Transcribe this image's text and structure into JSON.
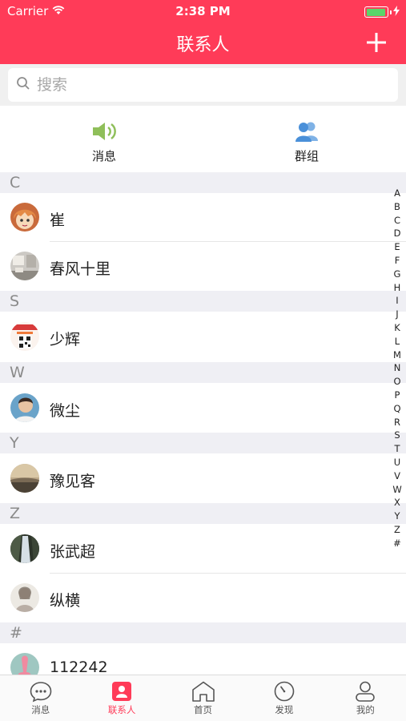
{
  "status_bar": {
    "carrier": "Carrier",
    "time": "2:38 PM",
    "battery_level": 0.95
  },
  "nav": {
    "title": "联系人",
    "add_icon": "plus-icon"
  },
  "search": {
    "placeholder": "搜索",
    "value": ""
  },
  "shortcuts": [
    {
      "label": "消息",
      "icon": "speaker-icon",
      "color": "#8fbf5a"
    },
    {
      "label": "群组",
      "icon": "group-icon",
      "color": "#4a90d9"
    }
  ],
  "sections": [
    {
      "letter": "C",
      "contacts": [
        {
          "name": "崔",
          "avatar": "anime-girl-avatar"
        },
        {
          "name": "春风十里",
          "avatar": "room-photo-avatar"
        }
      ]
    },
    {
      "letter": "S",
      "contacts": [
        {
          "name": "少辉",
          "avatar": "qr-poster-avatar"
        }
      ]
    },
    {
      "letter": "W",
      "contacts": [
        {
          "name": "微尘",
          "avatar": "man-portrait-avatar"
        }
      ]
    },
    {
      "letter": "Y",
      "contacts": [
        {
          "name": "豫见客",
          "avatar": "sunset-avatar"
        }
      ]
    },
    {
      "letter": "Z",
      "contacts": [
        {
          "name": "张武超",
          "avatar": "waterfall-avatar"
        },
        {
          "name": "纵横",
          "avatar": "sketch-avatar"
        }
      ]
    },
    {
      "letter": "#",
      "contacts": [
        {
          "name": "112242",
          "avatar": "flamingo-avatar"
        }
      ]
    }
  ],
  "index_letters": [
    "A",
    "B",
    "C",
    "D",
    "E",
    "F",
    "G",
    "H",
    "I",
    "J",
    "K",
    "L",
    "M",
    "N",
    "O",
    "P",
    "Q",
    "R",
    "S",
    "T",
    "U",
    "V",
    "W",
    "X",
    "Y",
    "Z",
    "#"
  ],
  "tabs": [
    {
      "label": "消息",
      "icon": "chat-bubble-icon",
      "active": false
    },
    {
      "label": "联系人",
      "icon": "contact-card-icon",
      "active": true
    },
    {
      "label": "首页",
      "icon": "home-icon",
      "active": false
    },
    {
      "label": "发现",
      "icon": "compass-icon",
      "active": false
    },
    {
      "label": "我的",
      "icon": "person-icon",
      "active": false
    }
  ],
  "colors": {
    "brand": "#ff3b58",
    "section_bg": "#efeff4",
    "battery": "#5bd66a"
  }
}
